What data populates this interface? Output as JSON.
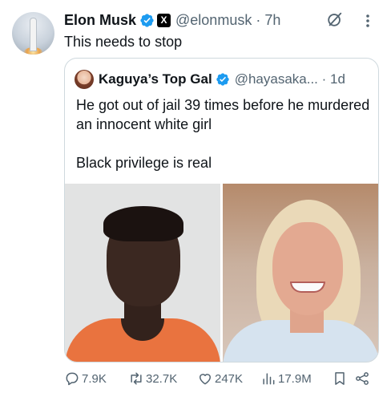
{
  "post": {
    "author": {
      "name": "Elon Musk",
      "handle": "@elonmusk",
      "time_sep": "·",
      "time": "7h",
      "badge_label": "X"
    },
    "text": "This needs to stop"
  },
  "quote": {
    "author": {
      "name": "Kaguya’s Top Gal",
      "handle": "@hayasaka...",
      "time_sep": "·",
      "time": "1d"
    },
    "text": "He got out of jail 39 times before he murdered an innocent white girl\n\nBlack privilege is real"
  },
  "actions": {
    "replies": "7.9K",
    "reposts": "32.7K",
    "likes": "247K",
    "views": "17.9M"
  },
  "icons": [
    "grok-icon",
    "more-icon",
    "verified-icon",
    "x-badge-icon",
    "reply-icon",
    "repost-icon",
    "like-icon",
    "views-icon",
    "bookmark-icon",
    "share-icon"
  ],
  "colors": {
    "verified": "#1d9bf0",
    "secondary_text": "#536471",
    "border": "#cfd9de"
  }
}
